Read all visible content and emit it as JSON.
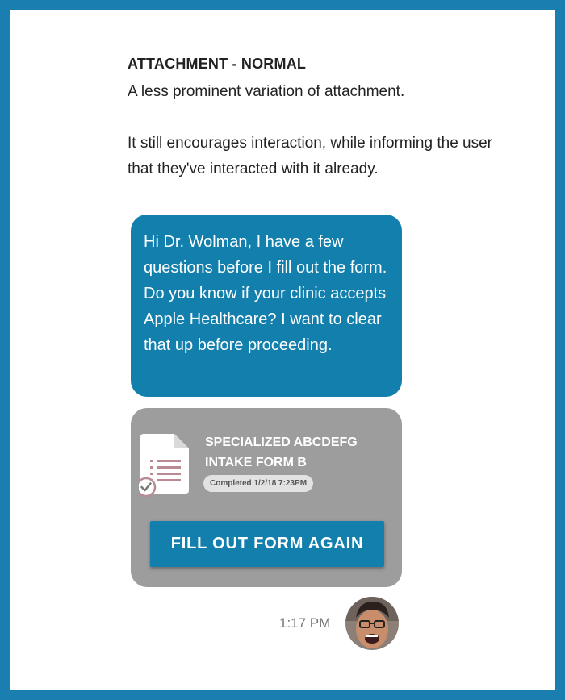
{
  "section": {
    "title": "ATTACHMENT - NORMAL",
    "description_1": "A less prominent variation of attachment.",
    "description_2": "It still encourages interaction, while informing the user that they've interacted with it already."
  },
  "message": {
    "text": "Hi Dr. Wolman, I have a few questions before I fill out the form. Do you know if your clinic accepts Apple Healthcare? I want to clear that up before proceeding."
  },
  "attachment": {
    "title_line_1": "SPECIALIZED ABCDEFG",
    "title_line_2": "INTAKE FORM B",
    "status": "Completed 1/2/18 7:23PM",
    "button_label": "FILL OUT FORM AGAIN",
    "icon": "document-icon",
    "status_icon": "checkmark-icon"
  },
  "meta": {
    "timestamp": "1:17 PM",
    "avatar_icon": "avatar"
  },
  "colors": {
    "accent": "#127fad",
    "border": "#1a7fb0",
    "card_bg": "#9d9d9d",
    "doc_lines": "#b98a92"
  }
}
